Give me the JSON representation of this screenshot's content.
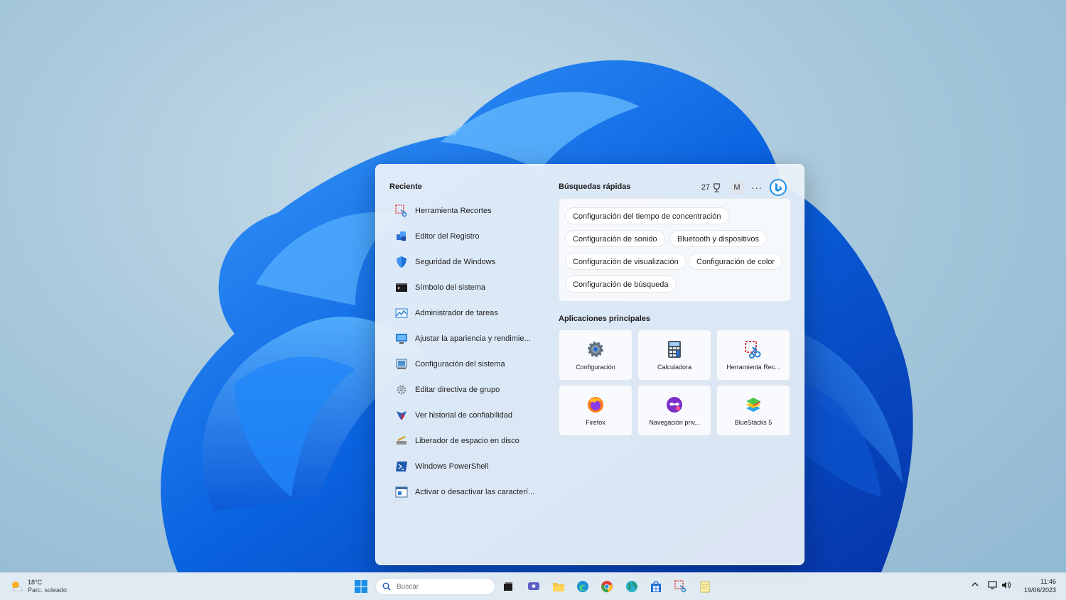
{
  "colors": {
    "accent": "#0a63d8",
    "bloom": "#1474f0",
    "panel_bg": "#ecf2f8"
  },
  "recent": {
    "title": "Reciente",
    "items": [
      {
        "label": "Herramienta Recortes",
        "icon": "snipping-tool-icon"
      },
      {
        "label": "Editor del Registro",
        "icon": "registry-editor-icon"
      },
      {
        "label": "Seguridad de Windows",
        "icon": "shield-icon"
      },
      {
        "label": "Símbolo del sistema",
        "icon": "command-prompt-icon"
      },
      {
        "label": "Administrador de tareas",
        "icon": "task-manager-icon"
      },
      {
        "label": "Ajustar la apariencia y rendimie...",
        "icon": "performance-icon"
      },
      {
        "label": "Configuración del sistema",
        "icon": "system-config-icon"
      },
      {
        "label": "Editar directiva de grupo",
        "icon": "group-policy-icon"
      },
      {
        "label": "Ver historial de confiabilidad",
        "icon": "reliability-icon"
      },
      {
        "label": "Liberador de espacio en disco",
        "icon": "disk-cleanup-icon"
      },
      {
        "label": "Windows PowerShell",
        "icon": "powershell-icon"
      },
      {
        "label": "Activar o desactivar las caracterí...",
        "icon": "windows-features-icon"
      }
    ]
  },
  "quick": {
    "title": "Búsquedas rápidas",
    "points": "27",
    "avatar": "M",
    "more": "···",
    "chips": [
      "Configuración del tiempo de concentración",
      "Configuración de sonido",
      "Bluetooth y dispositivos",
      "Configuración de visualización",
      "Configuración de color",
      "Configuración de búsqueda"
    ]
  },
  "apps": {
    "title": "Aplicaciones principales",
    "tiles": [
      {
        "label": "Configuración",
        "icon": "settings-icon"
      },
      {
        "label": "Calculadora",
        "icon": "calculator-icon"
      },
      {
        "label": "Herramienta Rec...",
        "icon": "snipping-tool-icon"
      },
      {
        "label": "Firefox",
        "icon": "firefox-icon"
      },
      {
        "label": "Navegación priv...",
        "icon": "private-browsing-icon"
      },
      {
        "label": "BlueStacks 5",
        "icon": "bluestacks-icon"
      }
    ]
  },
  "taskbar": {
    "weather_temp": "18°C",
    "weather_desc": "Parc. soleado",
    "search_placeholder": "Buscar",
    "clock_time": "11:46",
    "clock_date": "19/06/2023"
  }
}
